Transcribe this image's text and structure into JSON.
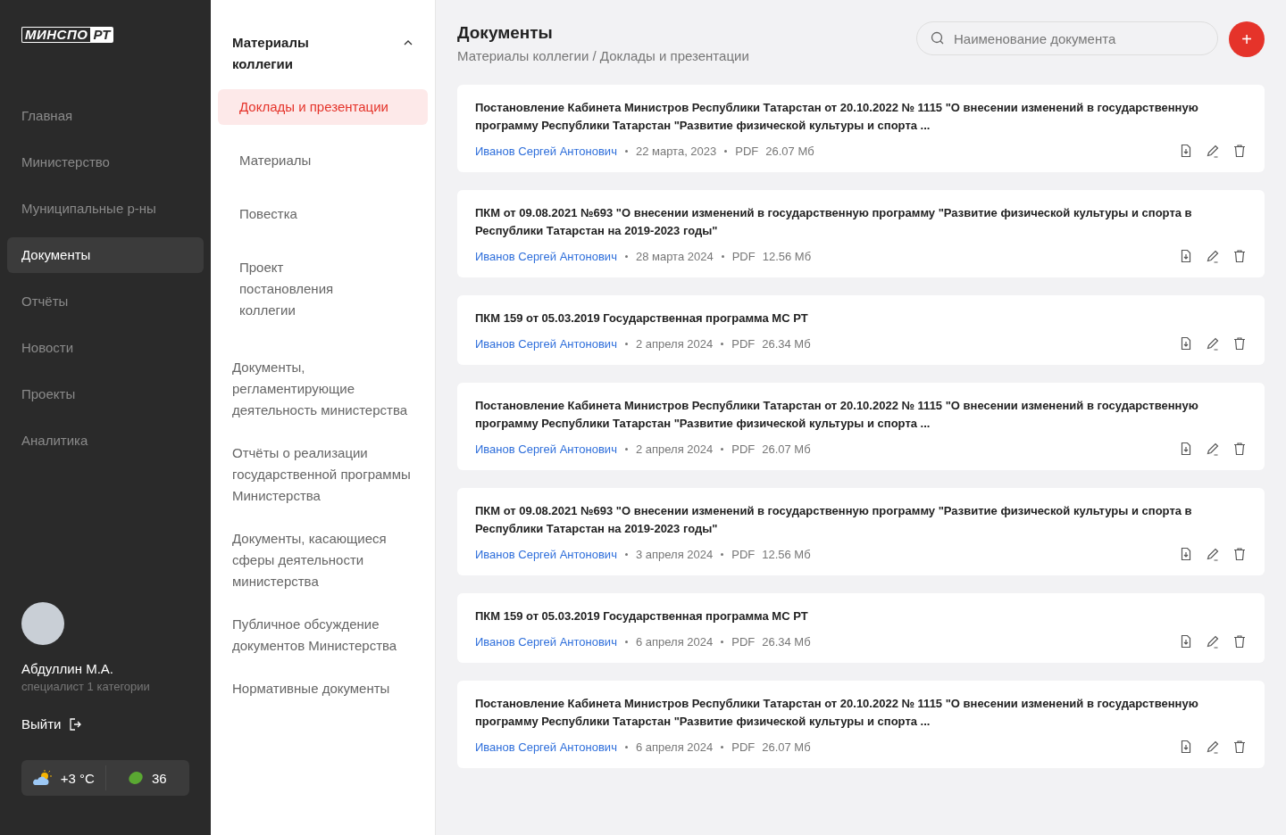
{
  "logo": {
    "part_1": "МИНСПО",
    "part_2": "РТ"
  },
  "nav": [
    {
      "label": "Главная",
      "selected": false
    },
    {
      "label": "Министерство",
      "selected": false
    },
    {
      "label": "Муниципальные р-ны",
      "selected": false
    },
    {
      "label": "Документы",
      "selected": true
    },
    {
      "label": "Отчёты",
      "selected": false
    },
    {
      "label": "Новости",
      "selected": false
    },
    {
      "label": "Проекты",
      "selected": false
    },
    {
      "label": "Аналитика",
      "selected": false
    }
  ],
  "user": {
    "name": "Абдуллин М.А.",
    "role": "специалист 1 категории",
    "logout": "Выйти"
  },
  "weather": {
    "temperature": "+3 °C",
    "eco_index": "36"
  },
  "categories": [
    {
      "label": "Материалы коллегии",
      "expanded": true,
      "children": [
        {
          "label": "Доклады и презентации",
          "selected": true
        },
        {
          "label": "Материалы",
          "selected": false
        },
        {
          "label": "Повестка",
          "selected": false
        },
        {
          "label": "Проект постановления коллегии",
          "selected": false
        }
      ]
    },
    {
      "label": "Документы, регламентирующие деятельность министерства"
    },
    {
      "label": "Отчёты о реализации государственной программы Министерства"
    },
    {
      "label": "Документы, касающиеся сферы деятельности министерства"
    },
    {
      "label": "Публичное обсуждение документов Министерства"
    },
    {
      "label": "Нормативные документы"
    }
  ],
  "header": {
    "title": "Документы",
    "breadcrumb": "Материалы коллегии / Доклады и презентации",
    "search_placeholder": "Наименование документа",
    "add_button": "+"
  },
  "documents": [
    {
      "title": "Постановление Кабинета Министров Республики Татарстан от 20.10.2022 № 1115 \"О внесении изменений в государственную программу Республики Татарстан \"Развитие физической культуры и спорта ...",
      "author": "Иванов Сергей Антонович",
      "date": "22 марта, 2023",
      "format": "PDF",
      "size": "26.07 Мб"
    },
    {
      "title": "ПКМ от 09.08.2021 №693 \"О внесении изменений в государственную программу \"Развитие физической культуры и спорта в Республики Татарстан на 2019-2023 годы\"",
      "author": "Иванов Сергей Антонович",
      "date": "28 марта 2024",
      "format": "PDF",
      "size": "12.56 Мб"
    },
    {
      "title": "ПКМ 159 от 05.03.2019 Государственная программа МС РТ",
      "author": "Иванов Сергей Антонович",
      "date": "2 апреля 2024",
      "format": "PDF",
      "size": "26.34 Мб"
    },
    {
      "title": "Постановление Кабинета Министров Республики Татарстан от 20.10.2022 № 1115 \"О внесении изменений в государственную программу Республики Татарстан \"Развитие физической культуры и спорта ...",
      "author": "Иванов Сергей Антонович",
      "date": "2 апреля 2024",
      "format": "PDF",
      "size": "26.07 Мб"
    },
    {
      "title": "ПКМ от 09.08.2021 №693 \"О внесении изменений в государственную программу \"Развитие физической культуры и спорта в Республики Татарстан на 2019-2023 годы\"",
      "author": "Иванов Сергей Антонович",
      "date": "3 апреля 2024",
      "format": "PDF",
      "size": "12.56 Мб"
    },
    {
      "title": "ПКМ 159 от 05.03.2019 Государственная программа МС РТ",
      "author": "Иванов Сергей Антонович",
      "date": "6 апреля 2024",
      "format": "PDF",
      "size": "26.34 Мб"
    },
    {
      "title": "Постановление Кабинета Министров Республики Татарстан от 20.10.2022 № 1115 \"О внесении изменений в государственную программу Республики Татарстан \"Развитие физической культуры и спорта ...",
      "author": "Иванов Сергей Антонович",
      "date": "6 апреля 2024",
      "format": "PDF",
      "size": "26.07 Мб"
    }
  ]
}
